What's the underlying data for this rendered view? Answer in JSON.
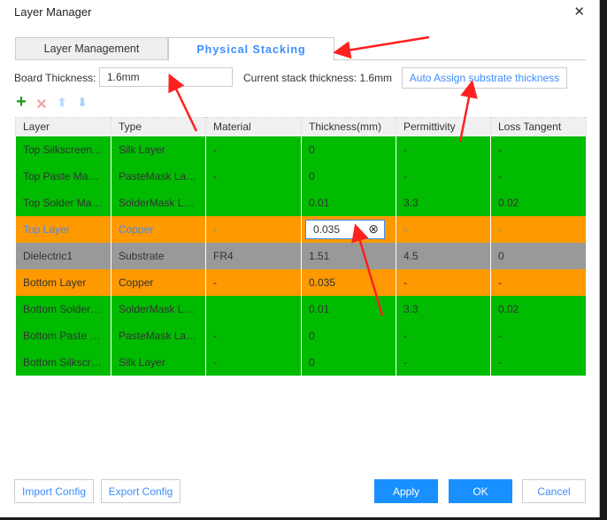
{
  "window": {
    "title": "Layer Manager",
    "close_icon": "close-icon"
  },
  "tabs": [
    {
      "label": "Layer Management",
      "active": false
    },
    {
      "label": "Physical Stacking",
      "active": true
    }
  ],
  "board": {
    "label": "Board Thickness:",
    "value": "1.6mm",
    "current_label": "Current stack thickness: 1.6mm",
    "auto_assign": "Auto Assign substrate thickness"
  },
  "toolbar": {
    "add": "+",
    "delete": "✕",
    "up": "⬆",
    "down": "⬇"
  },
  "table": {
    "columns": [
      "Layer",
      "Type",
      "Material",
      "Thickness(mm)",
      "Permittivity",
      "Loss Tangent"
    ],
    "rows": [
      {
        "color": "green",
        "cells": [
          "Top Silkscreen Layer",
          "Silk Layer",
          "-",
          "0",
          "-",
          "-"
        ]
      },
      {
        "color": "green",
        "cells": [
          "Top Paste Mask Layer",
          "PasteMask Layer",
          "-",
          "0",
          "-",
          "-"
        ]
      },
      {
        "color": "green",
        "cells": [
          "Top Solder Mask Layer",
          "SolderMask Layer",
          "",
          "0.01",
          "3.3",
          "0.02"
        ]
      },
      {
        "color": "orange",
        "selected": true,
        "cells": [
          "Top Layer",
          "Copper",
          "-",
          "0.035",
          "-",
          "-"
        ]
      },
      {
        "color": "gray",
        "cells": [
          "Dielectric1",
          "Substrate",
          "FR4",
          "1.51",
          "4.5",
          "0"
        ]
      },
      {
        "color": "orange",
        "cells": [
          "Bottom Layer",
          "Copper",
          "-",
          "0.035",
          "-",
          "-"
        ]
      },
      {
        "color": "green",
        "cells": [
          "Bottom Solder Mask Layer",
          "SolderMask Layer",
          "",
          "0.01",
          "3.3",
          "0.02"
        ]
      },
      {
        "color": "green",
        "cells": [
          "Bottom Paste Mask Layer",
          "PasteMask Layer",
          "-",
          "0",
          "-",
          "-"
        ]
      },
      {
        "color": "green",
        "cells": [
          "Bottom Silkscreen Layer",
          "Silk Layer",
          "-",
          "0",
          "-",
          "-"
        ]
      }
    ],
    "colors": {
      "green": "#00bb00",
      "orange": "#ff9900",
      "gray": "#999999"
    }
  },
  "footer": {
    "import": "Import Config",
    "export": "Export Config",
    "apply": "Apply",
    "ok": "OK",
    "cancel": "Cancel"
  },
  "accent": "#1890ff"
}
